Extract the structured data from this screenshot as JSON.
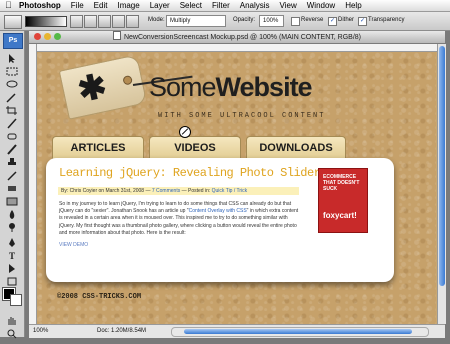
{
  "menubar": {
    "app": "Photoshop",
    "items": [
      "File",
      "Edit",
      "Image",
      "Layer",
      "Select",
      "Filter",
      "Analysis",
      "View",
      "Window",
      "Help"
    ]
  },
  "options": {
    "mode_label": "Mode:",
    "mode_value": "Multiply",
    "opacity_label": "Opacity:",
    "opacity_value": "100%",
    "reverse_label": "Reverse",
    "dither_label": "Dither",
    "transparency_label": "Transparency"
  },
  "tools": {
    "logo": "Ps"
  },
  "document": {
    "title": "NewConversionScreencast Mockup.psd @ 100% (MAIN CONTENT, RGB/8)",
    "zoom": "100%",
    "doc_size": "Doc: 1.20M/8.54M"
  },
  "site": {
    "brand_some": "Some",
    "brand_website": "Website",
    "tagline": "WITH SOME ULTRACOOL CONTENT",
    "nav": [
      "ARTICLES",
      "VIDEOS",
      "DOWNLOADS"
    ],
    "post": {
      "title": "Learning jQuery: Revealing Photo Slider",
      "meta_prefix": "By: Chris Coyier on March 31st, 2008 — ",
      "meta_comments": "7 Comments",
      "meta_mid": " — Posted in: ",
      "meta_category": "Quick Tip / Trick",
      "excerpt_1": "So in my journey to to learn jQuery, I'm trying to learn to do some things that CSS can already do but that jQuery can do \"sexier\". Jonathan Snook has an article up \"",
      "excerpt_link": "Content Overlay with CSS",
      "excerpt_2": "\" in which extra content is revealed in a certain area when it is moused over. This inspired me to try to do something similar with jQuery. My first thought was a thumbnail photo gallery, where clicking a button would reveal the entire photo and more information about that photo. Here is the result:",
      "view_demo": "VIEW DEMO"
    },
    "ad": {
      "text": "ECOMMERCE THAT DOESN'T SUCK",
      "logo": "foxycart!"
    },
    "footer": "©2008 CSS-TRICKS.COM"
  }
}
